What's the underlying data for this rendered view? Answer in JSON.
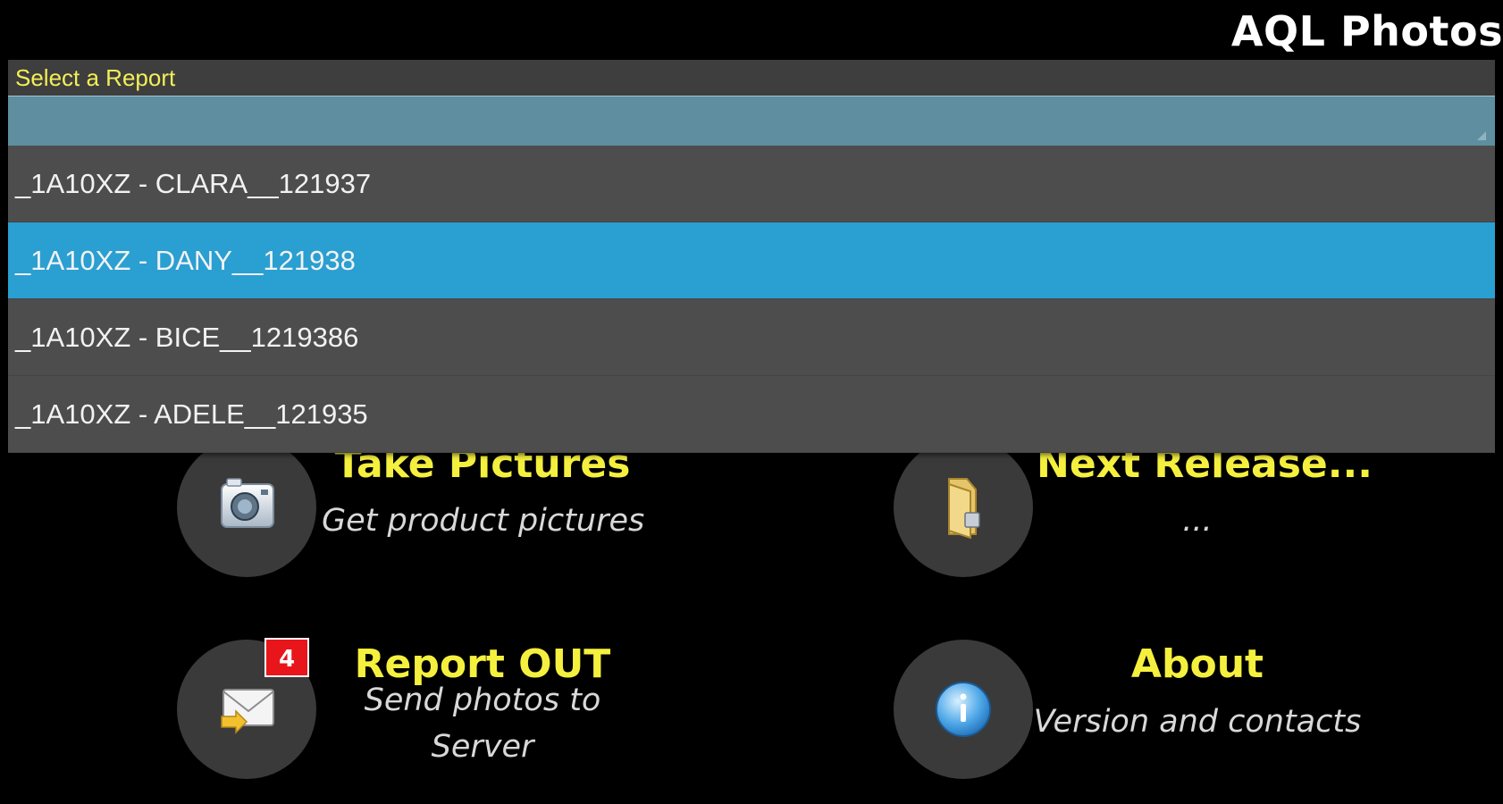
{
  "app": {
    "title": "AQL Photos"
  },
  "dropdown": {
    "label": "Select a Report",
    "selected_value": "",
    "options": [
      "_1A10XZ - CLARA__121937",
      "_1A10XZ - DANY__121938",
      "_1A10XZ - BICE__1219386",
      "_1A10XZ - ADELE__121935"
    ],
    "highlighted_index": 1
  },
  "tiles": {
    "take_pictures": {
      "title": "Take Pictures",
      "subtitle": "Get product pictures",
      "icon": "camera-icon"
    },
    "next_release": {
      "title": "Next Release...",
      "subtitle": "...",
      "icon": "folder-icon"
    },
    "report_out": {
      "title": "Report OUT",
      "subtitle_line1": "Send photos to",
      "subtitle_line2": "Server",
      "icon": "mail-send-icon",
      "badge": "4"
    },
    "about": {
      "title": "About",
      "subtitle": "Version and contacts",
      "icon": "info-icon"
    }
  },
  "colors": {
    "background": "#000000",
    "accent_yellow": "#f5f03e",
    "selection_blue": "#2a9fd1",
    "badge_red": "#e8161b"
  }
}
